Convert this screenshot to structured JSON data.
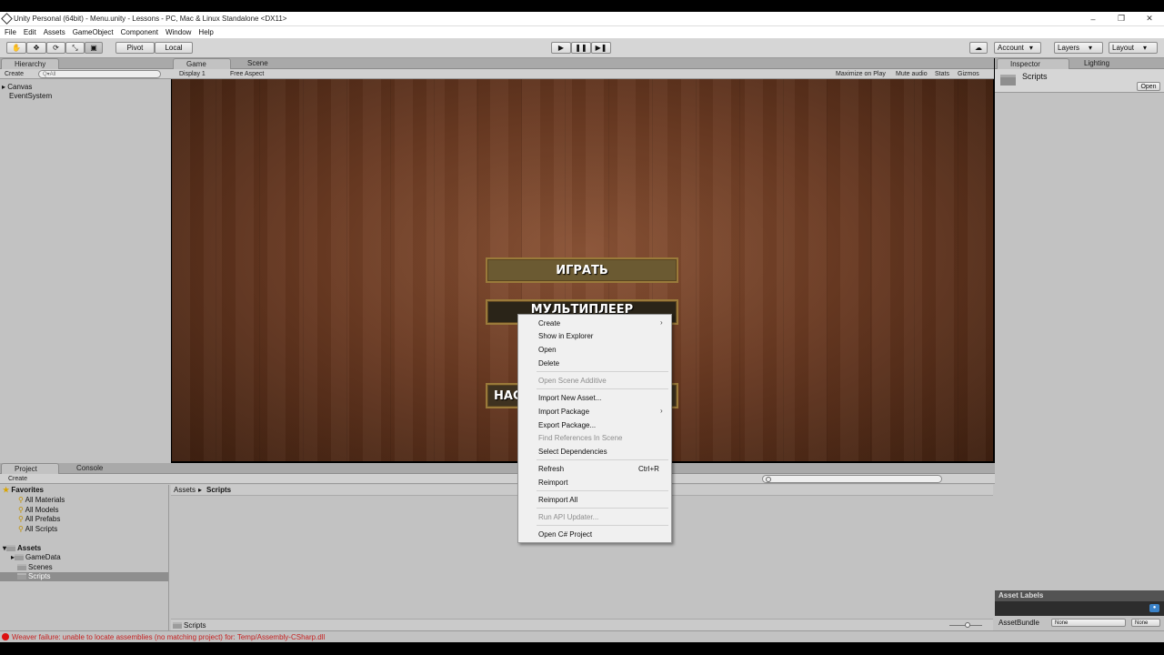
{
  "window": {
    "title": "Unity Personal (64bit) - Menu.unity - Lessons - PC, Mac & Linux Standalone <DX11>",
    "minimize": "–",
    "restore": "❐",
    "close": "✕"
  },
  "menubar": [
    "File",
    "Edit",
    "Assets",
    "GameObject",
    "Component",
    "Window",
    "Help"
  ],
  "toolbar": {
    "pivot": "Pivot",
    "local": "Local",
    "account": "Account",
    "layers": "Layers",
    "layout": "Layout"
  },
  "hierarchy": {
    "tab": "Hierarchy",
    "create": "Create",
    "search_placeholder": "Q▾All",
    "items": [
      "Canvas",
      "EventSystem"
    ]
  },
  "game": {
    "tabs": [
      "Game",
      "Scene"
    ],
    "display": "Display 1",
    "aspect": "Free Aspect",
    "options": [
      "Maximize on Play",
      "Mute audio",
      "Stats",
      "Gizmos"
    ],
    "buttons": [
      "ИГРАТЬ",
      "МУЛЬТИПЛЕЕР",
      "НАС"
    ]
  },
  "inspector": {
    "tabs": [
      "Inspector",
      "Lighting"
    ],
    "object": "Scripts",
    "open": "Open",
    "asset_labels": "Asset Labels",
    "asset_bundle": "AssetBundle",
    "bundle_value": "None",
    "variant_value": "None"
  },
  "project": {
    "tabs": [
      "Project",
      "Console"
    ],
    "create": "Create",
    "favorites_label": "Favorites",
    "favorites": [
      "All Materials",
      "All Models",
      "All Prefabs",
      "All Scripts"
    ],
    "assets_label": "Assets",
    "assets": [
      "GameData",
      "Scenes",
      "Scripts"
    ],
    "breadcrumb": [
      "Assets",
      "Scripts"
    ],
    "footer_path": "Scripts"
  },
  "context_menu": {
    "items": [
      {
        "label": "Create",
        "submenu": true,
        "disabled": false
      },
      {
        "label": "Show in Explorer",
        "disabled": false
      },
      {
        "label": "Open",
        "disabled": false
      },
      {
        "label": "Delete",
        "disabled": false
      },
      {
        "label": "Open Scene Additive",
        "disabled": true
      },
      {
        "label": "Import New Asset...",
        "disabled": false
      },
      {
        "label": "Import Package",
        "submenu": true,
        "disabled": false
      },
      {
        "label": "Export Package...",
        "disabled": false
      },
      {
        "label": "Find References In Scene",
        "disabled": true
      },
      {
        "label": "Select Dependencies",
        "disabled": false
      },
      {
        "label": "Refresh",
        "shortcut": "Ctrl+R",
        "disabled": false
      },
      {
        "label": "Reimport",
        "disabled": false
      },
      {
        "label": "Reimport All",
        "disabled": false
      },
      {
        "label": "Run API Updater...",
        "disabled": true
      },
      {
        "label": "Open C# Project",
        "disabled": false
      }
    ]
  },
  "status": {
    "message": "Weaver failure: unable to locate assemblies (no matching project) for: Temp/Assembly-CSharp.dll"
  }
}
